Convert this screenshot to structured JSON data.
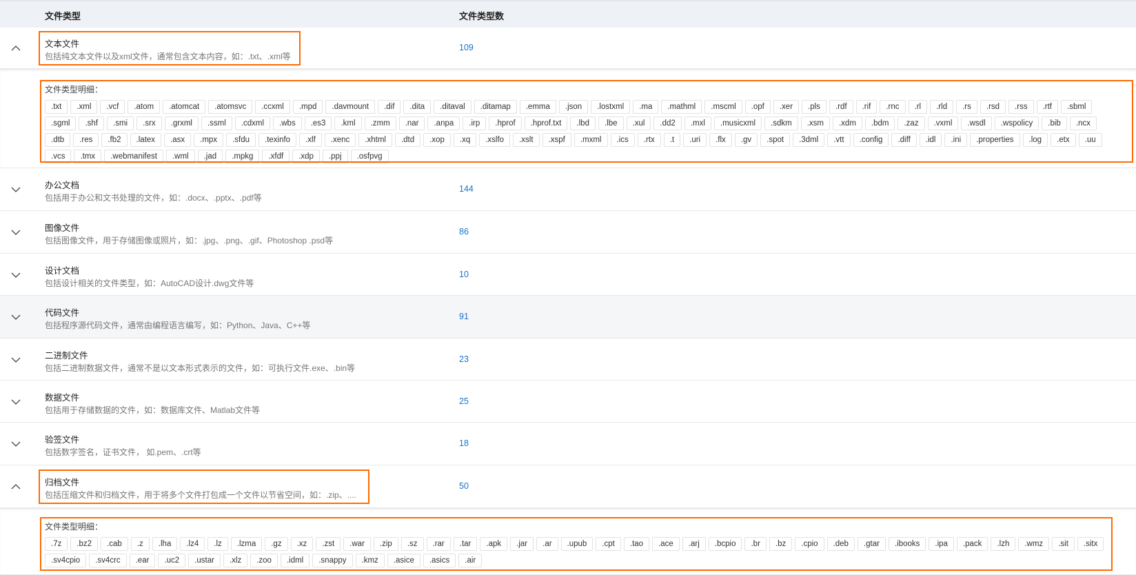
{
  "table": {
    "headers": {
      "type": "文件类型",
      "count": "文件类型数"
    },
    "detail_label": "文件类型明细：",
    "rows": [
      {
        "name": "文本文件",
        "desc": "包括纯文本文件以及xml文件，通常包含文本内容，如：.txt、.xml等",
        "count": "109",
        "expanded": true,
        "extensions": [
          ".txt",
          ".xml",
          ".vcf",
          ".atom",
          ".atomcat",
          ".atomsvc",
          ".ccxml",
          ".mpd",
          ".davmount",
          ".dif",
          ".dita",
          ".ditaval",
          ".ditamap",
          ".emma",
          ".json",
          ".lostxml",
          ".ma",
          ".mathml",
          ".mscml",
          ".opf",
          ".xer",
          ".pls",
          ".rdf",
          ".rif",
          ".rnc",
          ".rl",
          ".rld",
          ".rs",
          ".rsd",
          ".rss",
          ".rtf",
          ".sbml",
          ".sgml",
          ".shf",
          ".smi",
          ".srx",
          ".grxml",
          ".ssml",
          ".cdxml",
          ".wbs",
          ".es3",
          ".kml",
          ".zmm",
          ".nar",
          ".anpa",
          ".irp",
          ".hprof",
          ".hprof.txt",
          ".lbd",
          ".lbe",
          ".xul",
          ".dd2",
          ".mxl",
          ".musicxml",
          ".sdkm",
          ".xsm",
          ".xdm",
          ".bdm",
          ".zaz",
          ".vxml",
          ".wsdl",
          ".wspolicy",
          ".bib",
          ".ncx",
          ".dtb",
          ".res",
          ".fb2",
          ".latex",
          ".asx",
          ".mpx",
          ".sfdu",
          ".texinfo",
          ".xlf",
          ".xenc",
          ".xhtml",
          ".dtd",
          ".xop",
          ".xq",
          ".xslfo",
          ".xslt",
          ".xspf",
          ".mxml",
          ".ics",
          ".rtx",
          ".t",
          ".uri",
          ".flx",
          ".gv",
          ".spot",
          ".3dml",
          ".vtt",
          ".config",
          ".diff",
          ".idl",
          ".ini",
          ".properties",
          ".log",
          ".etx",
          ".uu",
          ".vcs",
          ".tmx",
          ".webmanifest",
          ".wml",
          ".jad",
          ".mpkg",
          ".xfdf",
          ".xdp",
          ".ppj",
          ".osfpvg"
        ]
      },
      {
        "name": "办公文档",
        "desc": "包括用于办公和文书处理的文件，如：.docx、.pptx、.pdf等",
        "count": "144",
        "expanded": false
      },
      {
        "name": "图像文件",
        "desc": "包括图像文件，用于存储图像或照片，如：.jpg、.png、.gif、Photoshop .psd等",
        "count": "86",
        "expanded": false
      },
      {
        "name": "设计文档",
        "desc": "包括设计相关的文件类型，如：AutoCAD设计.dwg文件等",
        "count": "10",
        "expanded": false
      },
      {
        "name": "代码文件",
        "desc": "包括程序源代码文件，通常由编程语言编写，如：Python、Java、C++等",
        "count": "91",
        "expanded": false
      },
      {
        "name": "二进制文件",
        "desc": "包括二进制数据文件，通常不是以文本形式表示的文件，如：可执行文件.exe、.bin等",
        "count": "23",
        "expanded": false
      },
      {
        "name": "数据文件",
        "desc": "包括用于存储数据的文件，如：数据库文件、Matlab文件等",
        "count": "25",
        "expanded": false
      },
      {
        "name": "验签文件",
        "desc": "包括数字签名，证书文件， 如.pem、.crt等",
        "count": "18",
        "expanded": false
      },
      {
        "name": "归档文件",
        "desc": "包括压缩文件和归档文件，用于将多个文件打包成一个文件以节省空间，如：.zip、....",
        "count": "50",
        "expanded": true,
        "extensions": [
          ".7z",
          ".bz2",
          ".cab",
          ".z",
          ".lha",
          ".lz4",
          ".lz",
          ".lzma",
          ".gz",
          ".xz",
          ".zst",
          ".war",
          ".zip",
          ".sz",
          ".rar",
          ".tar",
          ".apk",
          ".jar",
          ".ar",
          ".upub",
          ".cpt",
          ".tao",
          ".ace",
          ".arj",
          ".bcpio",
          ".br",
          ".bz",
          ".cpio",
          ".deb",
          ".gtar",
          ".ibooks",
          ".ipa",
          ".pack",
          ".lzh",
          ".wmz",
          ".sit",
          ".sitx",
          ".sv4cpio",
          ".sv4crc",
          ".ear",
          ".uc2",
          ".ustar",
          ".xlz",
          ".zoo",
          ".idml",
          ".snappy",
          ".kmz",
          ".asice",
          ".asics",
          ".air"
        ]
      }
    ]
  },
  "colors": {
    "highlight": "#ff6a00",
    "count": "#1a73c8"
  }
}
